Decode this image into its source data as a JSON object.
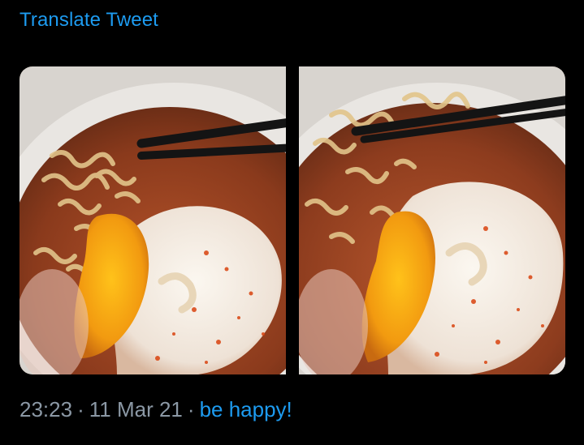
{
  "tweet": {
    "translate_label": "Translate Tweet",
    "time": "23:23",
    "date": "11 Mar 21",
    "separator": "·",
    "source": "be happy!"
  },
  "media": {
    "count": 2,
    "photos": [
      {
        "subject": "bowl of spicy noodle soup with a poached egg and chopsticks"
      },
      {
        "subject": "bowl of spicy noodle soup with a poached egg and chopsticks"
      }
    ]
  },
  "colors": {
    "background": "#000000",
    "link": "#1d9bf0",
    "secondary_text": "#8b98a5"
  }
}
